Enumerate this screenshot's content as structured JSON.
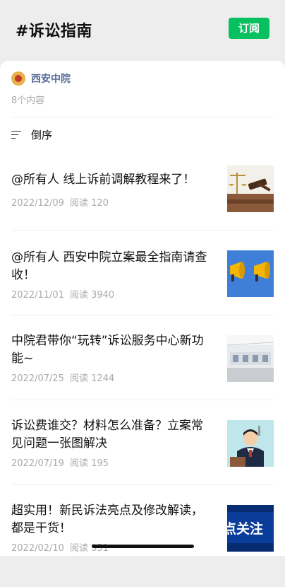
{
  "header": {
    "title": "#诉讼指南",
    "subscribe_label": "订阅"
  },
  "source": {
    "name": "西安中院",
    "count": "8个内容"
  },
  "sort": {
    "label": "倒序"
  },
  "articles": [
    {
      "title": "@所有人 线上诉前调解教程来了！",
      "date": "2022/12/09",
      "reads": "阅读 120"
    },
    {
      "title": "@所有人 西安中院立案最全指南请查收！",
      "date": "2022/11/01",
      "reads": "阅读 3940"
    },
    {
      "title": "中院君带你“玩转”诉讼服务中心新功能~",
      "date": "2022/07/25",
      "reads": "阅读 1244"
    },
    {
      "title": "诉讼费谁交？材料怎么准备？立案常见问题一张图解决",
      "date": "2022/07/19",
      "reads": "阅读 195"
    },
    {
      "title": "超实用！新民诉法亮点及修改解读，都是干货！",
      "date": "2022/02/10",
      "reads": "阅读 351"
    }
  ],
  "thumbnails": {
    "thumb5_text": "点关注"
  }
}
